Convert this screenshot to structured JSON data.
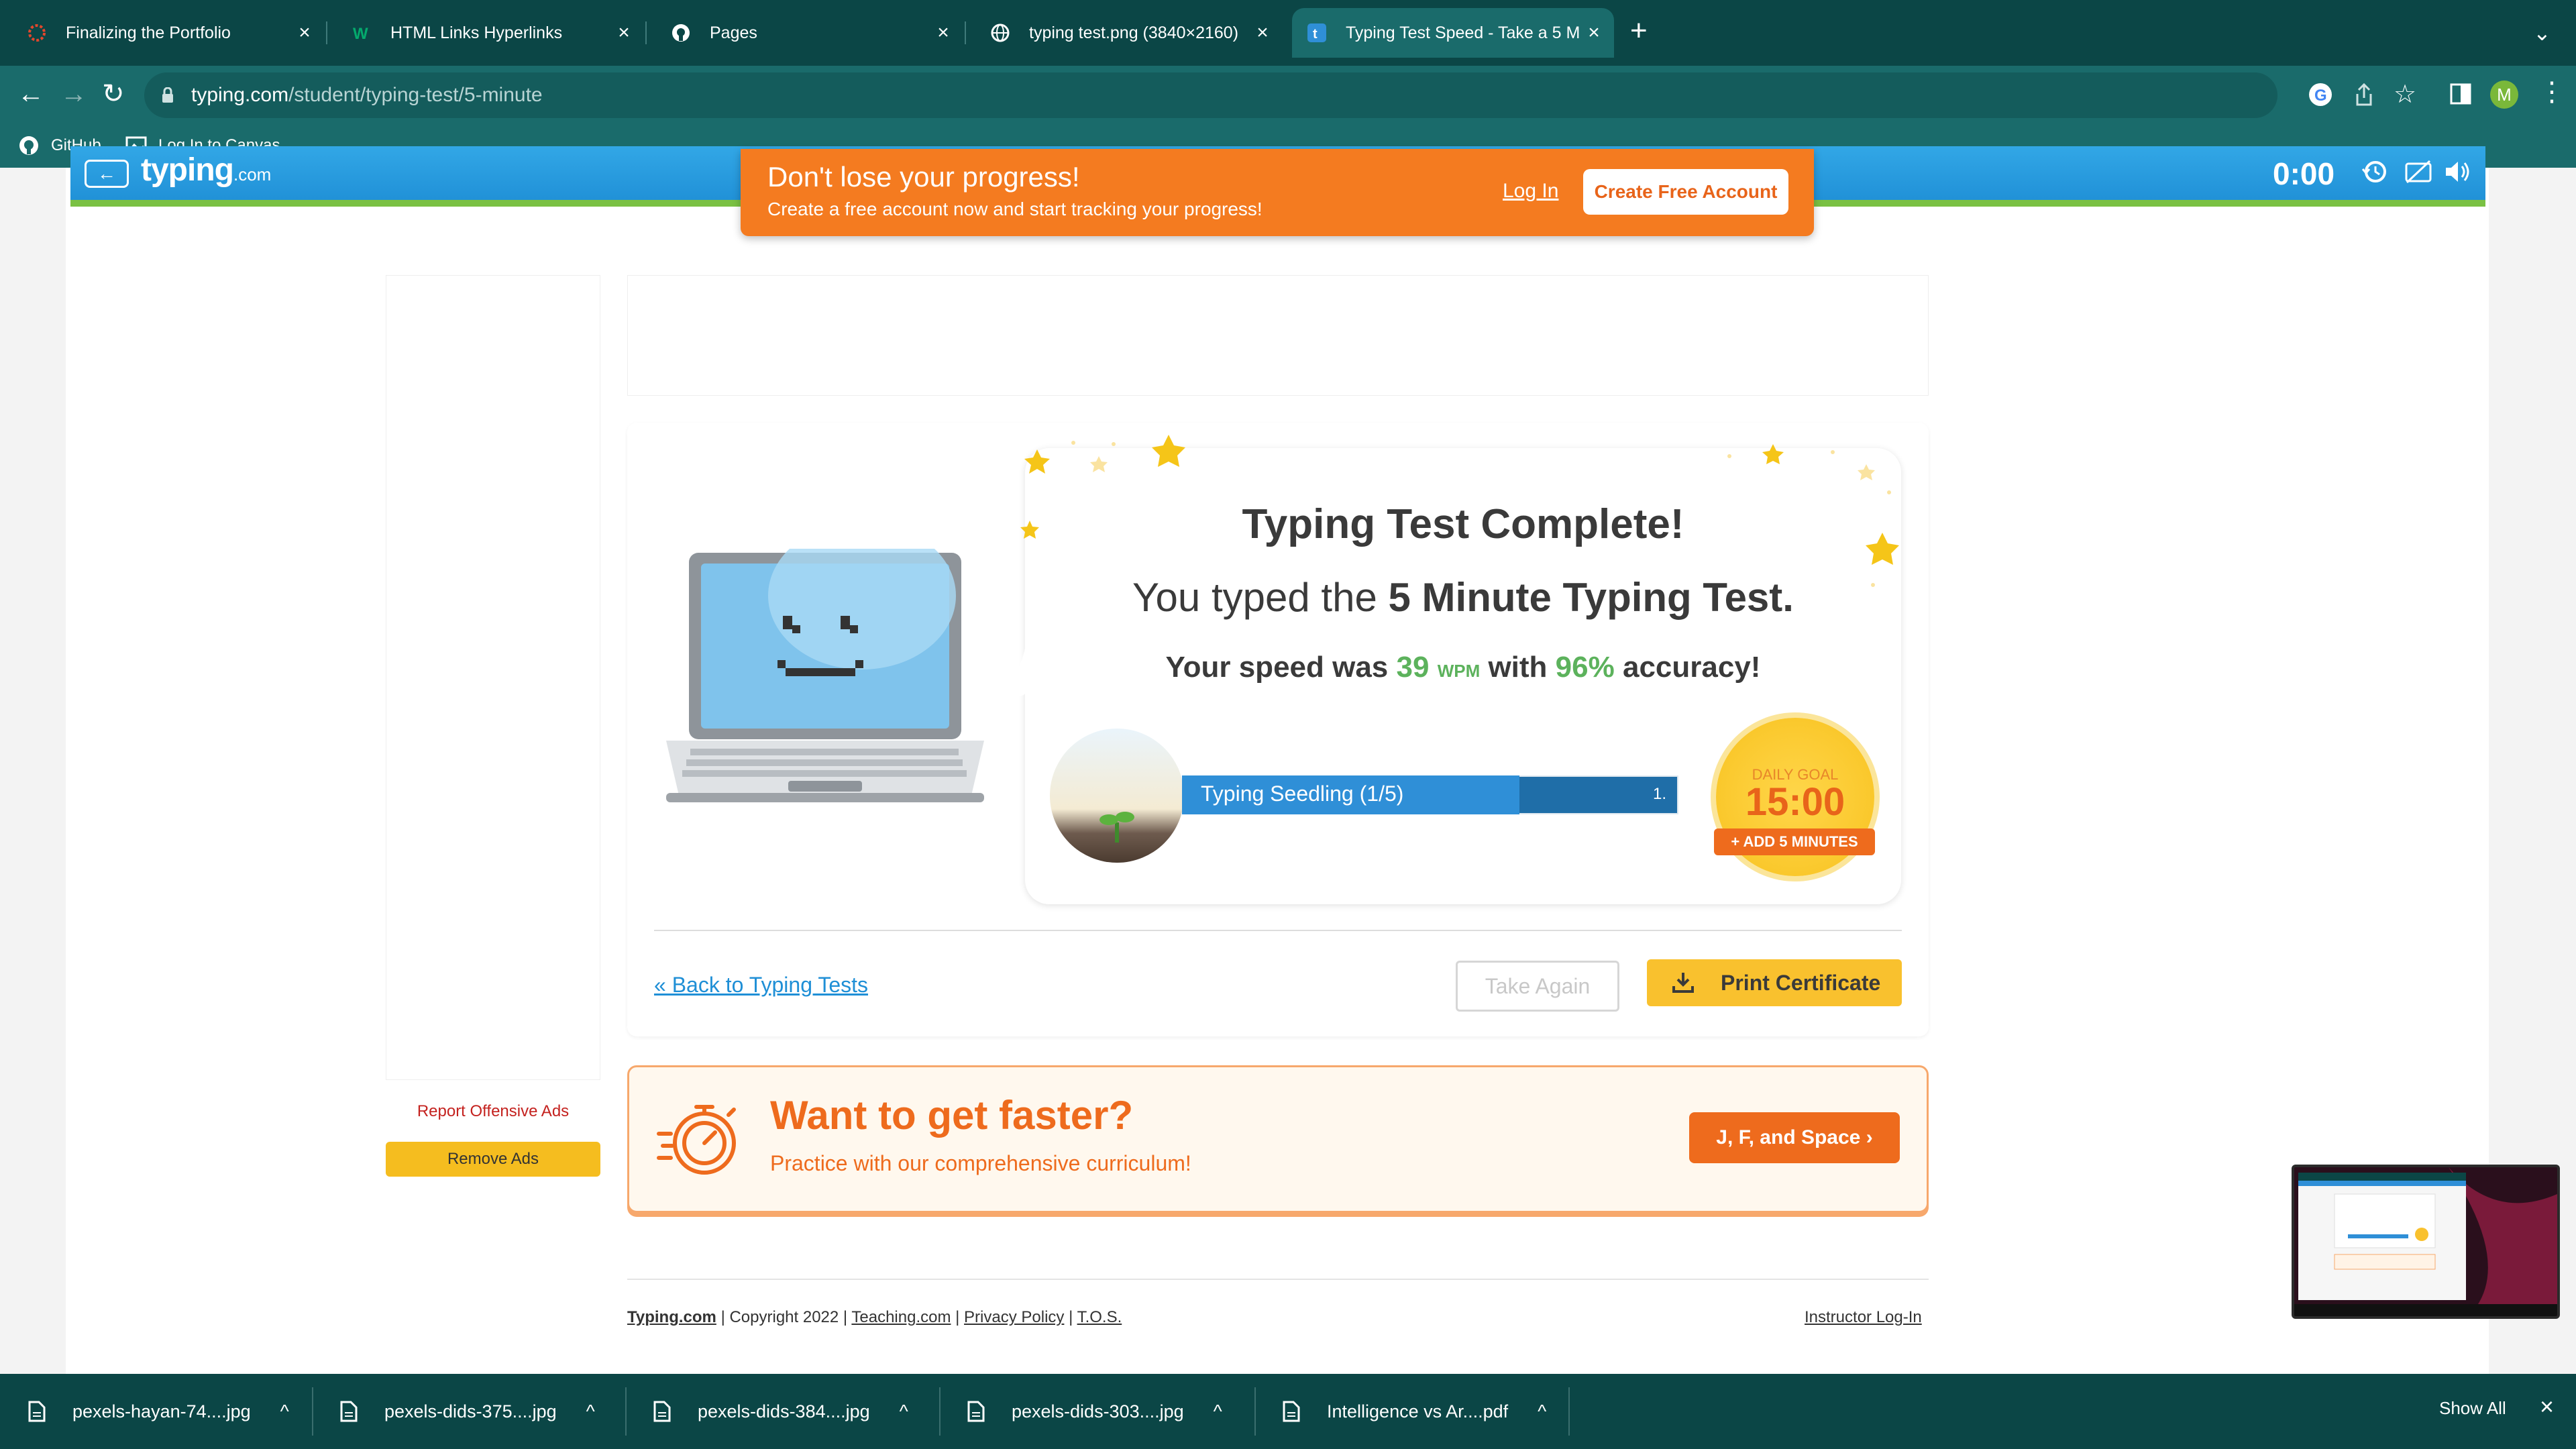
{
  "browser": {
    "tabs": [
      {
        "title": "Finalizing the Portfolio",
        "icon": "canvas-icon"
      },
      {
        "title": "HTML Links Hyperlinks",
        "icon": "w3schools-icon"
      },
      {
        "title": "Pages",
        "icon": "github-icon"
      },
      {
        "title": "typing test.png (3840×2160)",
        "icon": "globe-icon"
      },
      {
        "title": "Typing Test Speed - Take a 5 M",
        "icon": "typing-icon",
        "active": true
      }
    ],
    "url_host": "typing.com",
    "url_path": "/student/typing-test/5-minute",
    "profile_initial": "M",
    "bookmarks": [
      {
        "label": "GitHub",
        "icon": "github-icon"
      },
      {
        "label": "Log In to Canvas",
        "icon": "image-icon"
      }
    ]
  },
  "site": {
    "logo": "typing",
    "logo_suffix": ".com",
    "timer": "0:00"
  },
  "banner": {
    "title": "Don't lose your progress!",
    "subtitle": "Create a free account now and start tracking your progress!",
    "login": "Log In",
    "create": "Create Free Account"
  },
  "ads": {
    "report": "Report Offensive Ads",
    "remove": "Remove Ads"
  },
  "results": {
    "title": "Typing Test Complete!",
    "typed_prefix": "You typed the ",
    "typed_bold": "5 Minute Typing Test.",
    "speed_prefix": "Your speed was ",
    "wpm_value": "39",
    "wpm_unit": "WPM",
    "speed_mid": " with ",
    "accuracy": "96%",
    "speed_suffix": " accuracy!",
    "level_label": "Typing Seedling (1/5)",
    "level_value": "1.",
    "level_progress": 0.68,
    "goal_label": "DAILY GOAL",
    "goal_time": "15:00",
    "add_minutes": "+ ADD 5 MINUTES",
    "back_link": "« Back to Typing Tests",
    "take_again": "Take Again",
    "print": "Print Certificate"
  },
  "promo": {
    "title": "Want to get faster?",
    "subtitle": "Practice with our comprehensive curriculum!",
    "button": "J, F, and Space ›"
  },
  "footer": {
    "brand": "Typing.com",
    "copyright": "Copyright 2022",
    "teaching": "Teaching.com",
    "privacy": "Privacy Policy",
    "tos": "T.O.S.",
    "instructor": "Instructor Log-In"
  },
  "downloads": {
    "items": [
      "pexels-hayan-74....jpg",
      "pexels-dids-375....jpg",
      "pexels-dids-384....jpg",
      "pexels-dids-303....jpg",
      "Intelligence vs Ar....pdf"
    ],
    "show_all": "Show All"
  },
  "colors": {
    "chrome_dark": "#0b4646",
    "chrome_light": "#1a6b6b",
    "header_blue": "#1f8fd6",
    "orange": "#ee6b1d",
    "yellow": "#f9c12e",
    "green": "#5cb25c"
  }
}
